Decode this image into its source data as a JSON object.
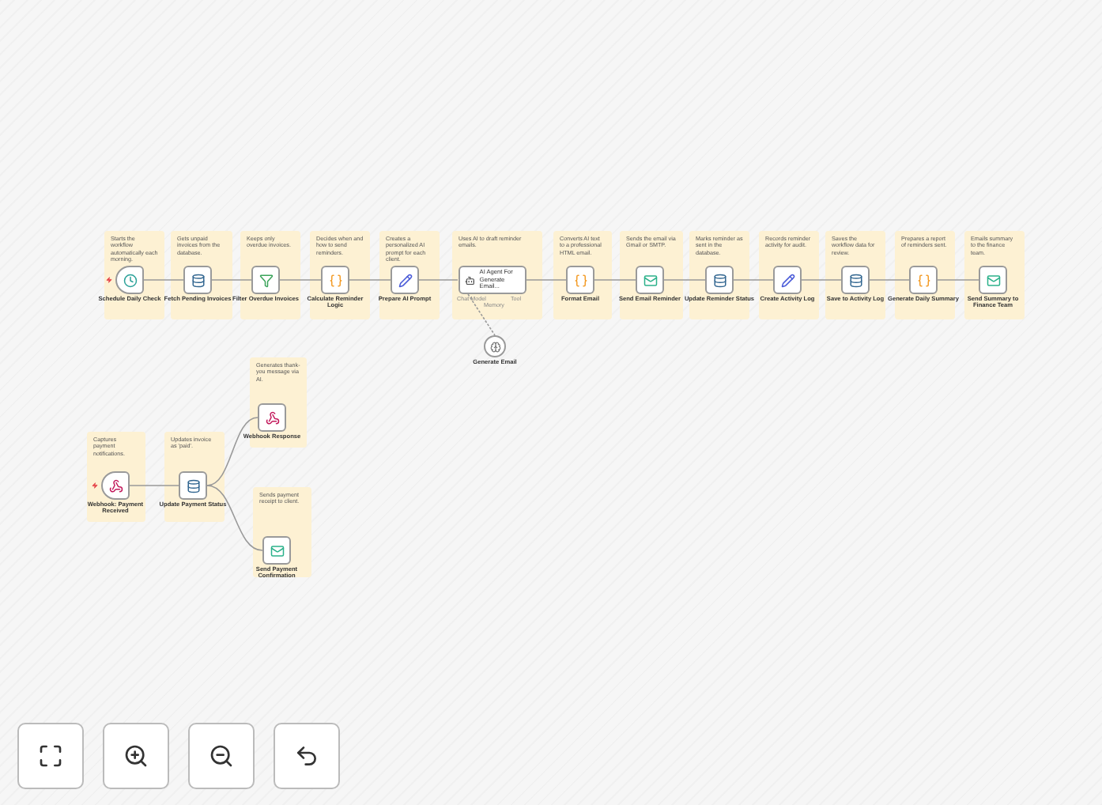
{
  "nodes": [
    {
      "kind": "trigger",
      "label": "Schedule Daily Check",
      "note": "Starts the workflow automatically each morning."
    },
    {
      "kind": "action",
      "label": "Fetch Pending Invoices",
      "note": "Gets unpaid invoices from the database."
    },
    {
      "kind": "action",
      "label": "Filter Overdue Invoices",
      "note": "Keeps only overdue invoices."
    },
    {
      "kind": "action",
      "label": "Calculate Reminder Logic",
      "note": "Decides when and how to send reminders."
    },
    {
      "kind": "action",
      "label": "Prepare AI Prompt",
      "note": "Creates a personalized AI prompt for each client."
    },
    {
      "kind": "agent",
      "label": "AI Agent For Generate Email...",
      "note": "Uses AI to draft reminder emails.",
      "inputs": [
        "Chat Model",
        "Memory",
        "Tool"
      ]
    },
    {
      "kind": "action",
      "label": "Format Email",
      "note": "Converts AI text to a professional HTML email."
    },
    {
      "kind": "action",
      "label": "Send Email Reminder",
      "note": "Sends the email via Gmail or SMTP."
    },
    {
      "kind": "action",
      "label": "Update Reminder Status",
      "note": "Marks reminder as sent in the database."
    },
    {
      "kind": "action",
      "label": "Create Activity Log",
      "note": "Records reminder activity for audit."
    },
    {
      "kind": "action",
      "label": "Save to Activity Log",
      "note": "Saves the workflow data for review."
    },
    {
      "kind": "action",
      "label": "Generate Daily Summary",
      "note": "Prepares a report of reminders sent."
    },
    {
      "kind": "action",
      "label": "Send Summary to Finance Team",
      "note": "Emails summary to the finance team."
    },
    {
      "kind": "trigger",
      "label": "Webhook: Payment Received",
      "note": "Captures payment notifications."
    },
    {
      "kind": "action",
      "label": "Update Payment Status",
      "note": "Updates invoice as 'paid'."
    },
    {
      "kind": "action",
      "label": "Webhook Response",
      "note": "Generates thank-you message via AI."
    },
    {
      "kind": "action",
      "label": "Send Payment Confirmation",
      "note": "Sends payment receipt to client."
    }
  ],
  "sub_node": {
    "kind": "model",
    "label": "Generate Email"
  }
}
